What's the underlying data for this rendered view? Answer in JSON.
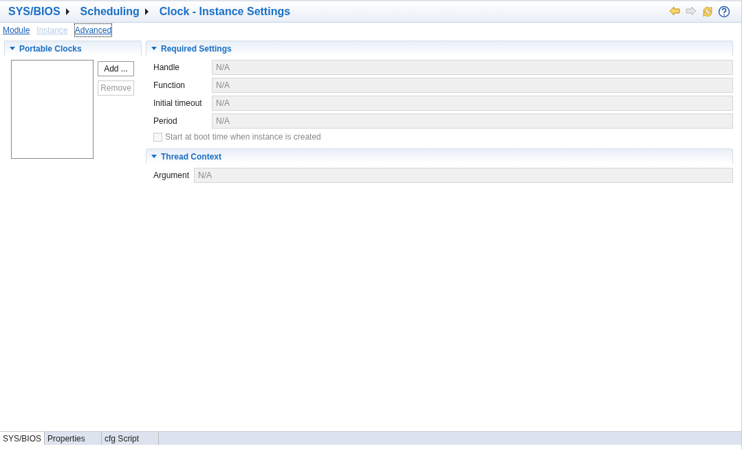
{
  "breadcrumb": [
    {
      "label": "SYS/BIOS"
    },
    {
      "label": "Scheduling"
    },
    {
      "label": "Clock - Instance Settings"
    }
  ],
  "toolbar": [
    {
      "kind": "back",
      "disabled": false
    },
    {
      "kind": "forward",
      "disabled": true
    },
    {
      "kind": "sync",
      "disabled": false
    },
    {
      "kind": "help",
      "disabled": false
    }
  ],
  "nav_links": [
    {
      "label": "Module",
      "disabled": false,
      "focused": false
    },
    {
      "label": "Instance",
      "disabled": true,
      "focused": false
    },
    {
      "label": "Advanced",
      "disabled": false,
      "focused": true
    }
  ],
  "portable_clocks": {
    "title": "Portable Clocks",
    "expanded": true,
    "buttons": [
      {
        "label": "Add ...",
        "disabled": false
      },
      {
        "label": "Remove",
        "disabled": true
      }
    ]
  },
  "required_settings": {
    "title": "Required Settings",
    "expanded": true,
    "fields": [
      {
        "label": "Handle",
        "value": "N/A"
      },
      {
        "label": "Function",
        "value": "N/A"
      },
      {
        "label": "Initial timeout",
        "value": "N/A"
      },
      {
        "label": "Period",
        "value": "N/A"
      }
    ],
    "checkbox": {
      "label": "Start at boot time when instance is created",
      "checked": false,
      "disabled": true
    }
  },
  "thread_context": {
    "title": "Thread Context",
    "expanded": true,
    "fields": [
      {
        "label": "Argument",
        "value": "N/A"
      }
    ]
  },
  "bottom_tabs": [
    {
      "label": "SYS/BIOS",
      "selected": true
    },
    {
      "label": "Properties",
      "selected": false
    },
    {
      "label": "cfg Script",
      "selected": false
    }
  ]
}
